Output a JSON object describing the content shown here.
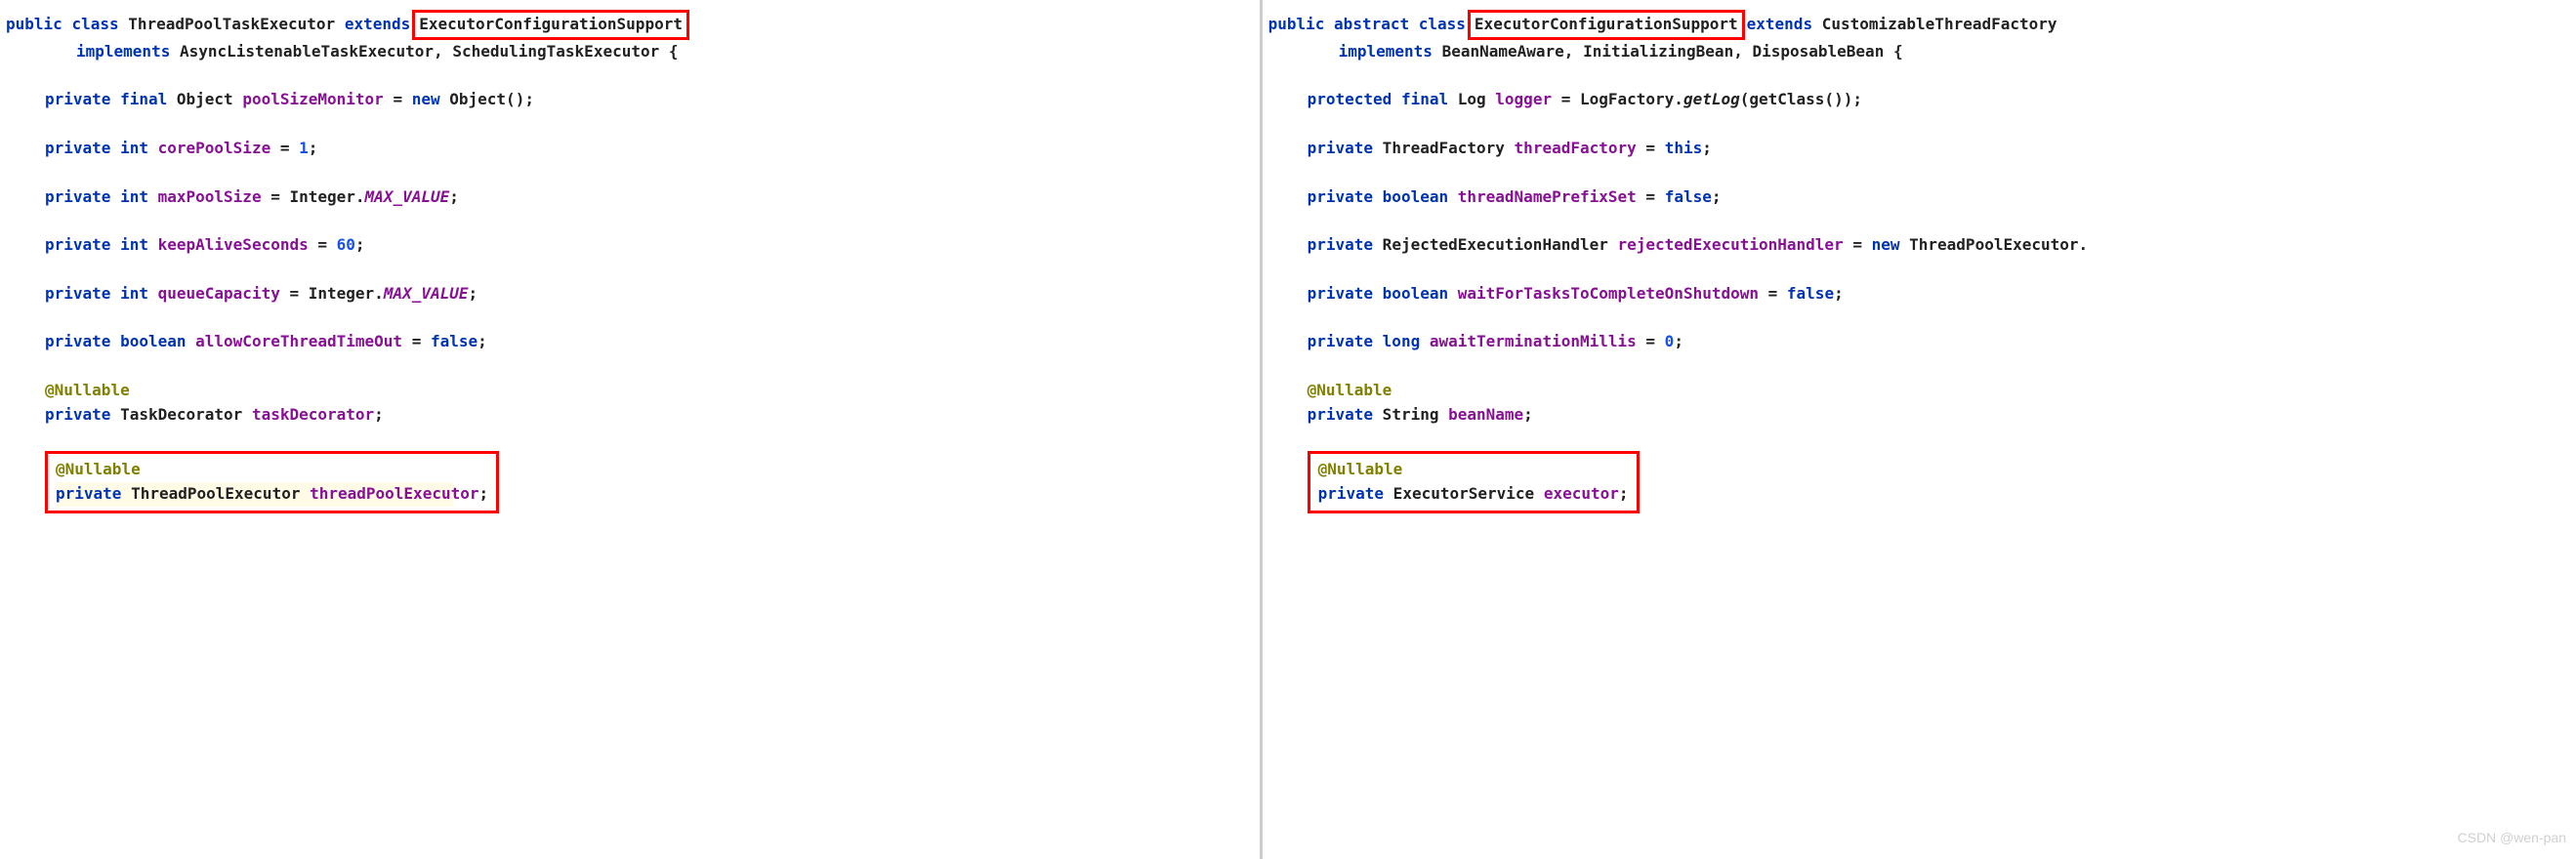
{
  "left": {
    "decl_public": "public",
    "decl_class": "class",
    "class_name": "ThreadPoolTaskExecutor",
    "extends_kw": "extends",
    "super_class": "ExecutorConfigurationSupport",
    "implements_kw": "implements",
    "implements_list": "AsyncListenableTaskExecutor, SchedulingTaskExecutor {",
    "line1_mods": "private final",
    "line1_type": "Object",
    "line1_field": "poolSizeMonitor",
    "line1_eq": " = ",
    "line1_new": "new",
    "line1_ctor": " Object();",
    "line2_mods": "private int",
    "line2_field": "corePoolSize",
    "line2_rest": " = ",
    "line2_val": "1",
    "line2_semi": ";",
    "line3_mods": "private int",
    "line3_field": "maxPoolSize",
    "line3_rest": " = Integer.",
    "line3_const": "MAX_VALUE",
    "line3_semi": ";",
    "line4_mods": "private int",
    "line4_field": "keepAliveSeconds",
    "line4_rest": " = ",
    "line4_val": "60",
    "line4_semi": ";",
    "line5_mods": "private int",
    "line5_field": "queueCapacity",
    "line5_rest": " = Integer.",
    "line5_const": "MAX_VALUE",
    "line5_semi": ";",
    "line6_mods": "private boolean",
    "line6_field": "allowCoreThreadTimeOut",
    "line6_rest": " = ",
    "line6_val": "false",
    "line6_semi": ";",
    "nullable1": "@Nullable",
    "line7_mods": "private",
    "line7_type": " TaskDecorator ",
    "line7_field": "taskDecorator",
    "line7_semi": ";",
    "nullable2": "@Nullable",
    "line8_mods": "private",
    "line8_type": " ThreadPoolExecutor ",
    "line8_field": "threadPoolExecutor",
    "line8_semi": ";"
  },
  "right": {
    "decl_public": "public",
    "decl_abstract": "abstract",
    "decl_class": "class",
    "class_name_boxed": "ExecutorConfigurationSupport",
    "extends_kw": "extends",
    "super_class": " CustomizableThreadFactory",
    "implements_kw": "implements",
    "implements_list": "BeanNameAware, InitializingBean, DisposableBean {",
    "line1_mods": "protected final",
    "line1_type": " Log ",
    "line1_field": "logger",
    "line1_rest": " = LogFactory.",
    "line1_method": "getLog",
    "line1_tail": "(getClass());",
    "line2_mods": "private",
    "line2_type": " ThreadFactory ",
    "line2_field": "threadFactory",
    "line2_rest": " = ",
    "line2_val": "this",
    "line2_semi": ";",
    "line3_mods": "private boolean",
    "line3_field": "threadNamePrefixSet",
    "line3_rest": " = ",
    "line3_val": "false",
    "line3_semi": ";",
    "line4_mods": "private",
    "line4_type": " RejectedExecutionHandler ",
    "line4_field": "rejectedExecutionHandler",
    "line4_rest": " = ",
    "line4_new": "new",
    "line4_tail": " ThreadPoolExecutor.",
    "line5_mods": "private boolean",
    "line5_field": "waitForTasksToCompleteOnShutdown",
    "line5_rest": " = ",
    "line5_val": "false",
    "line5_semi": ";",
    "line6_mods": "private long",
    "line6_field": "awaitTerminationMillis",
    "line6_rest": " = ",
    "line6_val": "0",
    "line6_semi": ";",
    "nullable1": "@Nullable",
    "line7_mods": "private",
    "line7_type": " String ",
    "line7_field": "beanName",
    "line7_semi": ";",
    "nullable2": "@Nullable",
    "line8_mods": "private",
    "line8_type": " ExecutorService ",
    "line8_field": "executor",
    "line8_semi": ";"
  },
  "watermark": "CSDN @wen-pan"
}
